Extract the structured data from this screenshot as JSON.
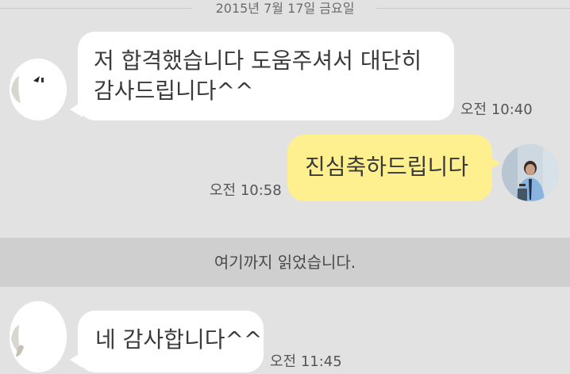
{
  "date_separator": "2015년 7월 17일 금요일",
  "messages": [
    {
      "side": "received",
      "text_line1": "저 합격했습니다 도움주셔서 대단히",
      "text_line2": "감사드립니다^^",
      "time": "오전 10:40"
    },
    {
      "side": "sent",
      "text": "진심축하드립니다",
      "time": "오전 10:58"
    },
    {
      "side": "received",
      "text": "네 감사합니다^^",
      "time": "오전 11:45"
    }
  ],
  "read_marker": "여기까지 읽었습니다.",
  "colors": {
    "background": "#e2e2e2",
    "sent_bubble": "#fef08e",
    "received_bubble": "#ffffff",
    "read_marker_bar": "#cfcfcf"
  }
}
